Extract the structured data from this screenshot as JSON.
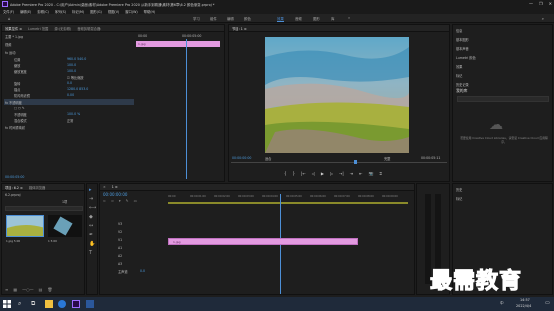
{
  "app": {
    "title": "Adobe Premiere Pro 2020 - C:\\用户\\Admin\\桌面\\素材\\Adobe Premiere Pro 2020 从新手到精通\\素材\\第6章\\6.2 颜色渐变.prproj *",
    "window_buttons": [
      "—",
      "❐",
      "✕"
    ]
  },
  "menu": [
    "文件(F)",
    "编辑(E)",
    "剪辑(C)",
    "序列(S)",
    "标记(M)",
    "图形(G)",
    "视图(V)",
    "窗口(W)",
    "帮助(H)"
  ],
  "workspaces": [
    "学习",
    "组件",
    "编辑",
    "颜色",
    "效果",
    "音频",
    "图形",
    "库",
    "»"
  ],
  "active_workspace": "效果",
  "effect_controls": {
    "tabs": [
      "效果控件 ≡",
      "Lumetri 范围",
      "源:(无剪辑)",
      "音频剪辑混合器:"
    ],
    "header": "主要 * 1.jpg",
    "clip": "1.jpg",
    "timecode_start": "00:00",
    "timecode_end": "00:00:05:00",
    "rows": [
      {
        "label": "视频",
        "value": ""
      },
      {
        "label": "fx 运动",
        "value": ""
      },
      {
        "label": "位置",
        "value": "960.0    540.0"
      },
      {
        "label": "缩放",
        "value": "100.0"
      },
      {
        "label": "缩放宽度",
        "value": "100.0"
      },
      {
        "label": "",
        "value": "☑ 等比缩放"
      },
      {
        "label": "旋转",
        "value": "0.0"
      },
      {
        "label": "锚点",
        "value": "1280.0   853.0"
      },
      {
        "label": "防闪烁滤镜",
        "value": "0.00"
      },
      {
        "label": "fx 不透明度",
        "value": ""
      },
      {
        "label": "",
        "value": "□ ○ ✎"
      },
      {
        "label": "不透明度",
        "value": "100.0 %"
      },
      {
        "label": "混合模式",
        "value": "正常"
      },
      {
        "label": "fx 时间重映射",
        "value": ""
      }
    ],
    "current_time": "00:00:05:00"
  },
  "program": {
    "tab": "节目: 1 ≡",
    "timecode": "00:00:00:00",
    "fit": "适合",
    "quality": "完整",
    "duration": "00:00:05:11",
    "controls": [
      "{",
      "}",
      "|←",
      "◁",
      "▶",
      "▷",
      "→|",
      "⇥",
      "⇤",
      "📷",
      "⌗"
    ]
  },
  "right_panel": {
    "items": [
      "信息",
      "基本图形",
      "基本声音",
      "Lumetri 颜色",
      "效果",
      "标记",
      "历史记录"
    ],
    "search_placeholder": "",
    "lib_title": "我的库",
    "cc_message": "若要使用 Creative Cloud Libraries，请安装 Creative Cloud 应用程序。",
    "bottom_items": [
      "历史",
      "标记"
    ]
  },
  "project": {
    "tabs": [
      "项目: 6.2 ≡",
      "媒体浏览器"
    ],
    "name": "6.2.prproj",
    "count": "1项",
    "items": [
      "1.jpg 5:00",
      "1 5:00"
    ]
  },
  "timeline": {
    "tab": "1 ≡",
    "timecode": "00:00:00:00",
    "ruler": [
      "00:00",
      "00:00:01:00",
      "00:00:02:00",
      "00:00:03:00",
      "00:00:04:00",
      "00:00:05:00",
      "00:00:06:00",
      "00:00:07:00",
      "00:00:08:00",
      "00:00:09:00"
    ],
    "tracks": [
      "V3",
      "V2",
      "V1",
      "A1",
      "A2",
      "A3",
      "主声道"
    ],
    "master_value": "0.0",
    "clip_label": "1.jpg"
  },
  "taskbar": {
    "time": "14:57",
    "date": "2022/4/4",
    "lang": "中"
  },
  "watermark": "最需教育",
  "colors": {
    "accent": "#4d8fd6",
    "clip": "#e39ae0"
  }
}
